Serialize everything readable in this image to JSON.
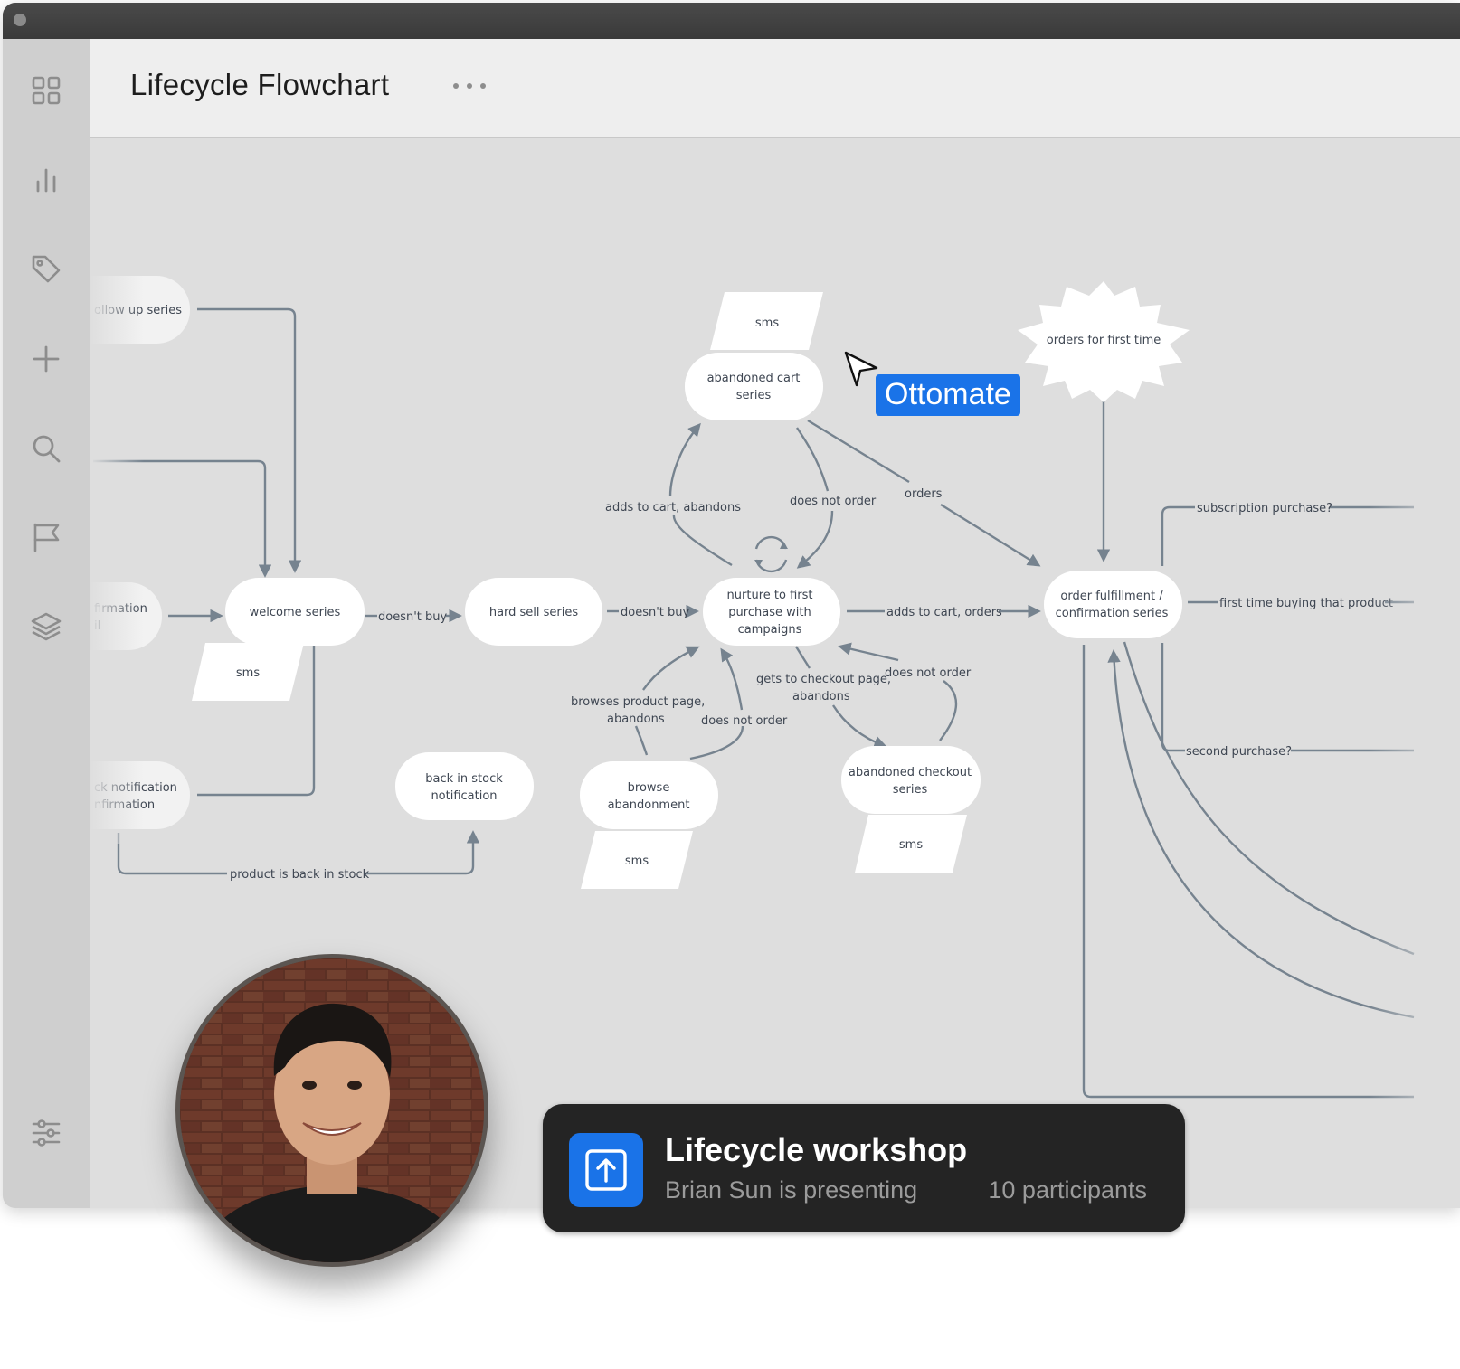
{
  "window": {
    "title": "Lifecycle Flowchart"
  },
  "sidebar": {
    "items": [
      {
        "icon": "grid-icon"
      },
      {
        "icon": "bar-chart-icon"
      },
      {
        "icon": "tag-icon"
      },
      {
        "icon": "plus-icon"
      },
      {
        "icon": "search-icon"
      },
      {
        "icon": "flag-icon"
      },
      {
        "icon": "layers-icon"
      },
      {
        "icon": "sliders-icon"
      }
    ]
  },
  "flow": {
    "nodes": {
      "follow_up": "ollow up series",
      "confirmation_1": "firmation",
      "confirmation_2": "il",
      "notification_1": "ck notification",
      "notification_2": "nfirmation",
      "welcome": "welcome series",
      "welcome_sms": "sms",
      "hard_sell": "hard sell series",
      "back_in_stock_1": "back in stock",
      "back_in_stock_2": "notification",
      "cart_sms": "sms",
      "abandoned_cart_1": "abandoned cart",
      "abandoned_cart_2": "series",
      "nurture_1": "nurture to first",
      "nurture_2": "purchase with",
      "nurture_3": "campaigns",
      "browse_1": "browse",
      "browse_2": "abandonment",
      "browse_sms": "sms",
      "checkout_1": "abandoned checkout",
      "checkout_2": "series",
      "checkout_sms": "sms",
      "first_time": "orders for first time",
      "fulfillment_1": "order fulfillment /",
      "fulfillment_2": "confirmation series"
    },
    "edges": {
      "doesnt_buy_1": "doesn't buy",
      "doesnt_buy_2": "doesn't buy",
      "adds_to_cart_abandons": "adds to cart, abandons",
      "does_not_order_1": "does not order",
      "orders": "orders",
      "adds_to_cart_orders": "adds to cart, orders",
      "browses_1": "browses product page,",
      "browses_2": "abandons",
      "does_not_order_2": "does not order",
      "gets_checkout_1": "gets to checkout page,",
      "gets_checkout_2": "abandons",
      "does_not_order_3": "does not order",
      "subscription": "subscription purchase?",
      "first_time_buying": "first time buying that product",
      "second_purchase": "second purchase?",
      "back_in_stock": "product is back in stock"
    }
  },
  "collaborator_cursor": {
    "label": "Ottomate",
    "color": "#1a73e8"
  },
  "presentation": {
    "title": "Lifecycle workshop",
    "presenter": "Brian Sun is presenting",
    "participants": "10 participants",
    "icon": "present-upload-icon",
    "accent": "#1a73e8"
  }
}
